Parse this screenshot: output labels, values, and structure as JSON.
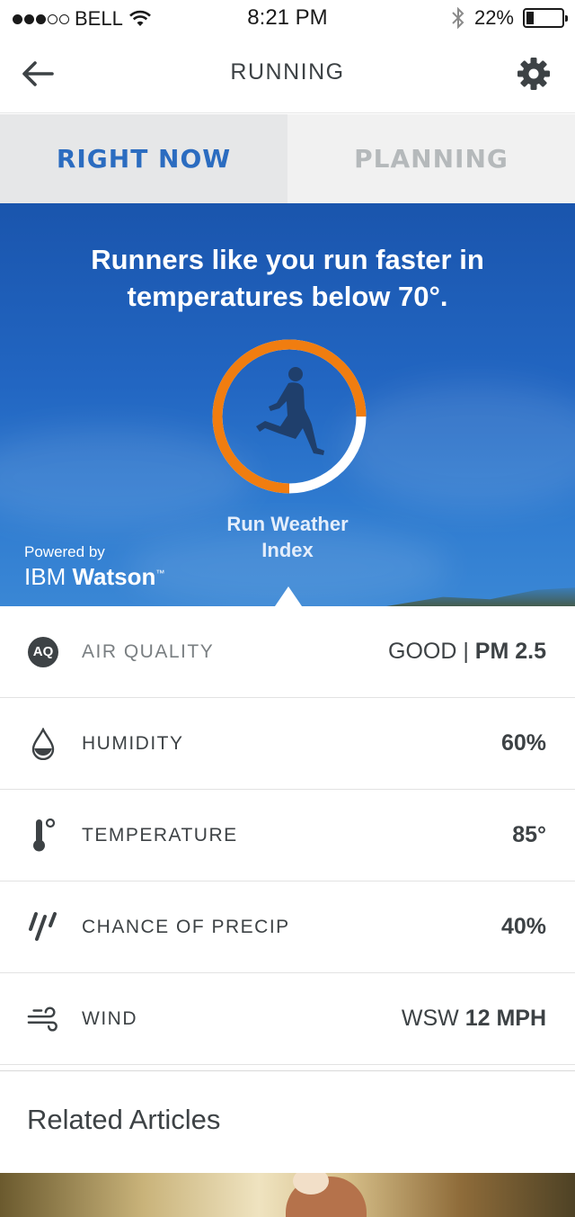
{
  "status_bar": {
    "carrier": "BELL",
    "time": "8:21 PM",
    "battery": "22%",
    "battery_level": 0.22,
    "signal_bars_filled": 3,
    "signal_bars_total": 5
  },
  "nav": {
    "title": "RUNNING",
    "back_icon": "arrow-left-icon",
    "settings_icon": "gear-icon"
  },
  "tabs": [
    {
      "label": "RIGHT NOW",
      "active": true
    },
    {
      "label": "PLANNING",
      "active": false
    }
  ],
  "hero": {
    "message": "Runners like you run faster in temperatures below 70°.",
    "index_label_line1": "Run Weather",
    "index_label_line2": "Index",
    "index_fill_fraction": 0.75,
    "powered_by": "Powered by",
    "brand_prefix": "IBM",
    "brand_name": "Watson",
    "brand_tm": "™",
    "gauge_color": "#f07d10",
    "gauge_track_color": "#ffffff",
    "runner_icon": "runner-icon"
  },
  "metrics": [
    {
      "icon": "aq-badge-icon",
      "badge_text": "AQ",
      "label": "AIR QUALITY",
      "value_light": "GOOD | ",
      "value_bold": "PM 2.5"
    },
    {
      "icon": "droplet-icon",
      "label": "HUMIDITY",
      "value_light": "",
      "value_bold": "60%"
    },
    {
      "icon": "thermometer-icon",
      "label": "TEMPERATURE",
      "value_light": "",
      "value_bold": "85°"
    },
    {
      "icon": "rain-icon",
      "label": "CHANCE OF PRECIP",
      "value_light": "",
      "value_bold": "40%"
    },
    {
      "icon": "wind-icon",
      "label": "WIND",
      "value_light": "WSW ",
      "value_bold": "12 MPH"
    }
  ],
  "related": {
    "title": "Related Articles"
  },
  "colors": {
    "accent_blue": "#2b6cc0",
    "orange": "#f07d10",
    "text_dark": "#3d4245"
  }
}
